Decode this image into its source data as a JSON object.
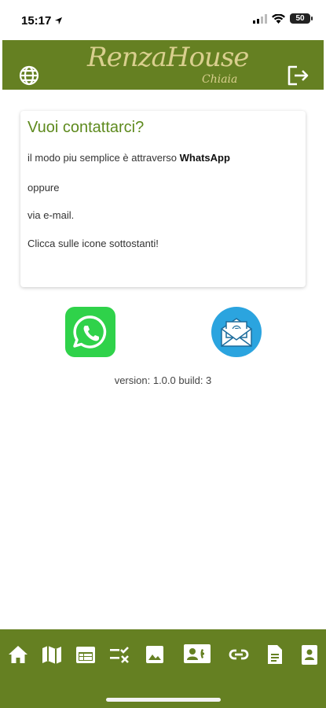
{
  "status_bar": {
    "time": "15:17",
    "battery": "50"
  },
  "header": {
    "logo_main": "RenzaHouse",
    "logo_sub": "Chiaia",
    "globe_icon": "globe-icon",
    "logout_icon": "logout-icon",
    "background": "#658022"
  },
  "card": {
    "title": "Vuoi contattarci?",
    "line1_prefix": "il modo piu semplice è attraverso ",
    "line1_bold": "WhatsApp",
    "line2": "oppure",
    "line3": "via e-mail.",
    "line4": "Clicca sulle icone sottostanti!",
    "title_color": "#5e8a1e"
  },
  "contacts": {
    "whatsapp_icon": "whatsapp-icon",
    "email_icon": "email-icon",
    "whatsapp_color": "#2fd24a",
    "email_color": "#2ba4df"
  },
  "version": "version: 1.0.0 build: 3",
  "bottom_nav": {
    "items": [
      {
        "icon": "home-icon",
        "active": false
      },
      {
        "icon": "map-icon",
        "active": false
      },
      {
        "icon": "calendar-icon",
        "active": false
      },
      {
        "icon": "checklist-icon",
        "active": false
      },
      {
        "icon": "image-icon",
        "active": false
      },
      {
        "icon": "contact-icon",
        "active": true
      },
      {
        "icon": "link-icon",
        "active": false
      },
      {
        "icon": "document-icon",
        "active": false
      },
      {
        "icon": "badge-icon",
        "active": false
      }
    ],
    "background": "#658022"
  }
}
